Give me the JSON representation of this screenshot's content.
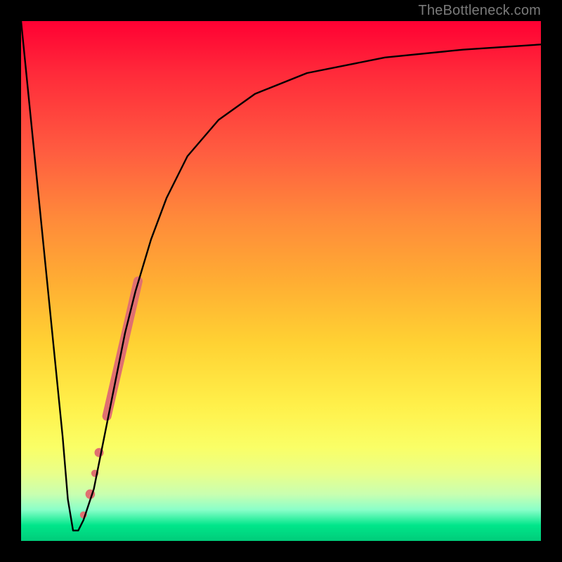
{
  "watermark": "TheBottleneck.com",
  "chart_data": {
    "type": "line",
    "title": "",
    "xlabel": "",
    "ylabel": "",
    "xlim": [
      0,
      100
    ],
    "ylim": [
      0,
      100
    ],
    "grid": false,
    "background": "vertical red-to-green gradient (red top, green bottom)",
    "series": [
      {
        "name": "bottleneck-curve",
        "x": [
          0,
          2,
          4,
          6,
          8,
          9,
          10,
          11,
          12,
          14,
          16,
          18,
          20,
          22,
          25,
          28,
          32,
          38,
          45,
          55,
          70,
          85,
          100
        ],
        "y": [
          100,
          80,
          60,
          40,
          20,
          8,
          2,
          2,
          4,
          10,
          20,
          30,
          40,
          48,
          58,
          66,
          74,
          81,
          86,
          90,
          93,
          94.5,
          95.5
        ]
      }
    ],
    "highlighted_segments": [
      {
        "name": "thick-band",
        "type": "line",
        "x": [
          16.5,
          22.5
        ],
        "y": [
          24,
          50
        ]
      },
      {
        "name": "dot-1",
        "type": "point",
        "x": 15.0,
        "y": 17
      },
      {
        "name": "dot-2",
        "type": "point",
        "x": 14.2,
        "y": 13
      },
      {
        "name": "dot-3",
        "type": "point",
        "x": 13.3,
        "y": 9
      },
      {
        "name": "dot-4",
        "type": "point",
        "x": 12.0,
        "y": 5
      }
    ]
  }
}
